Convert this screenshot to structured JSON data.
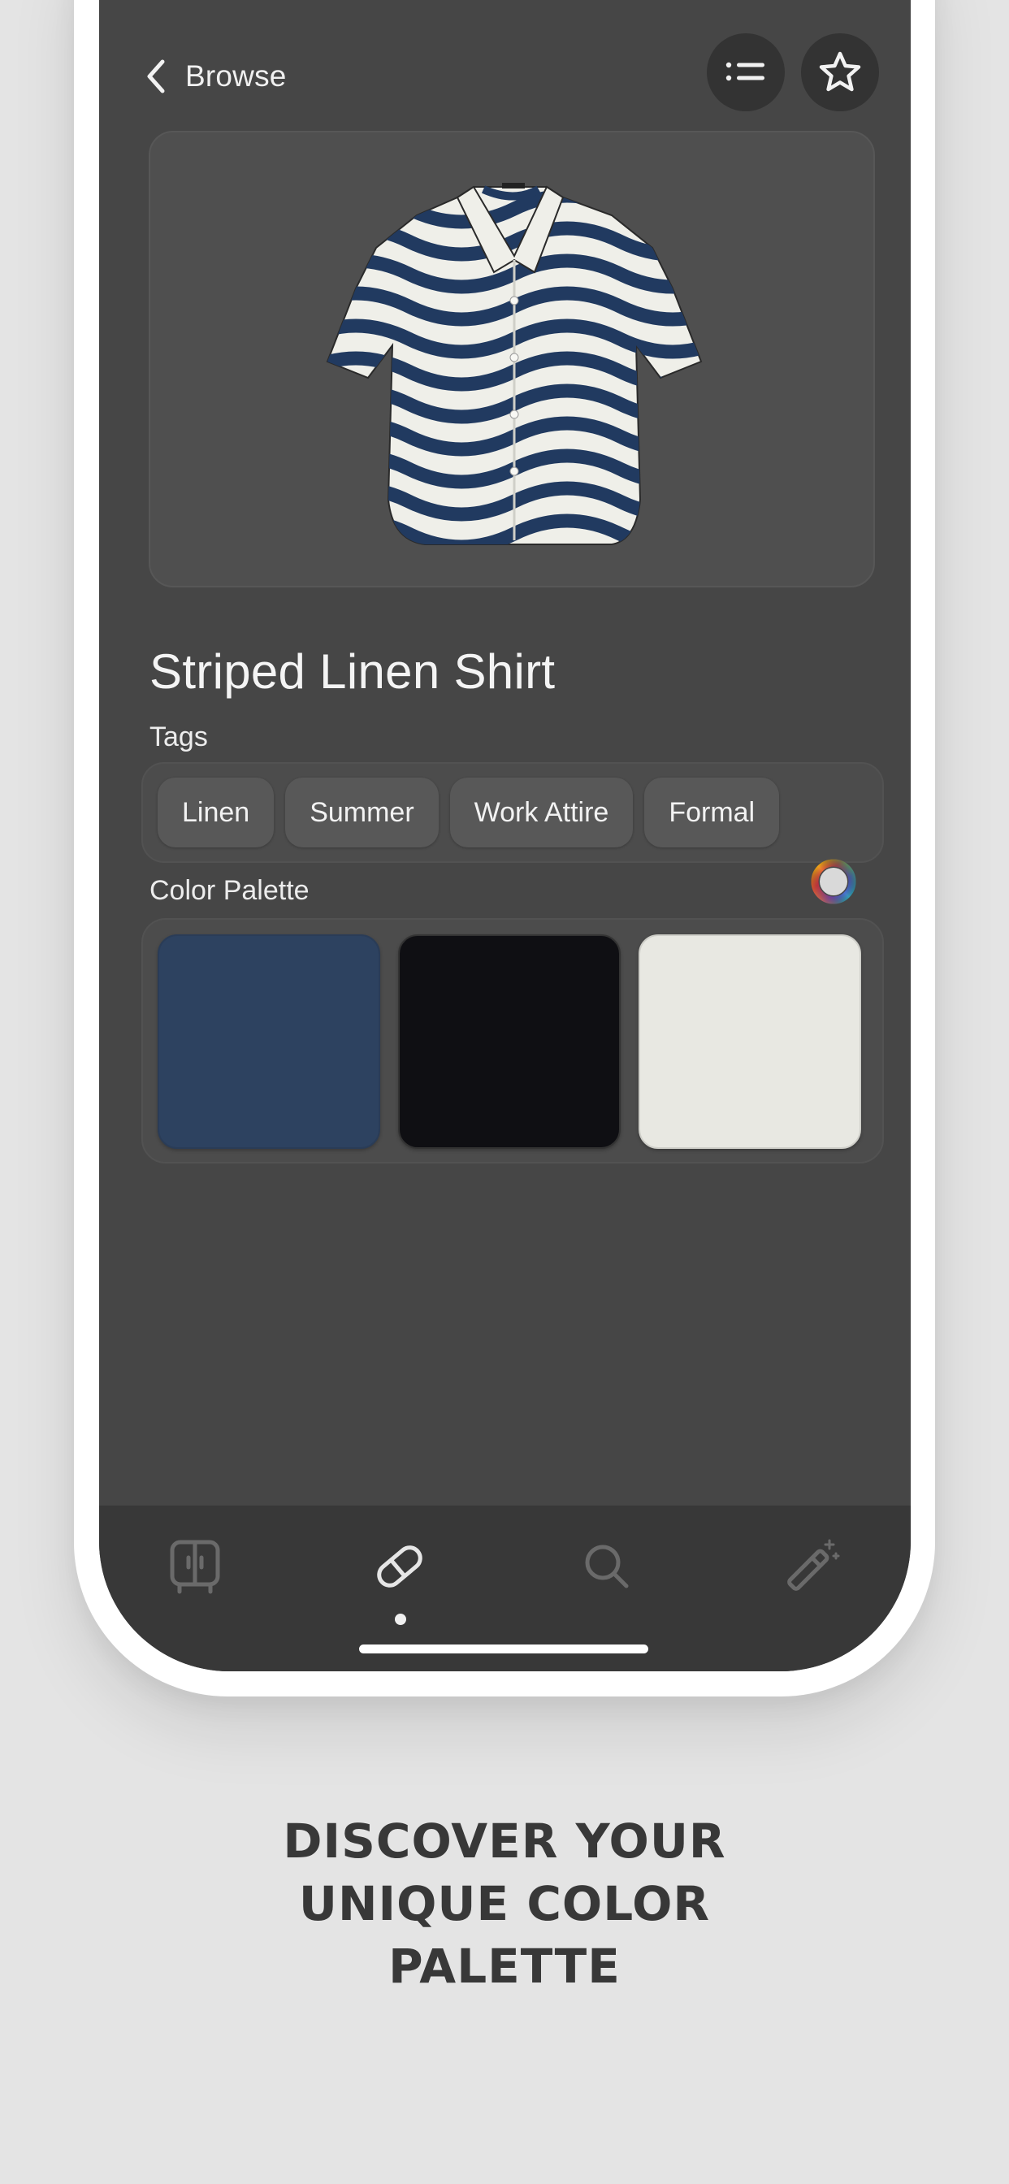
{
  "header": {
    "back_label": "Browse"
  },
  "product": {
    "title": "Striped Linen Shirt",
    "image_alt": "Striped linen shirt with navy and white wavy stripes"
  },
  "tags": {
    "label": "Tags",
    "items": [
      "Linen",
      "Summer",
      "Work Attire",
      "Formal"
    ]
  },
  "palette": {
    "label": "Color Palette",
    "colors": [
      "#2d4260",
      "#0f0f13",
      "#e8e8e2"
    ]
  },
  "tab_bar": {
    "active_tab": "items",
    "tabs": [
      "wardrobe-icon",
      "hanger-tag-icon",
      "search-icon",
      "magic-wand-icon"
    ]
  },
  "promo": {
    "line1": "DISCOVER YOUR",
    "line2": "UNIQUE COLOR",
    "line3": "PALETTE"
  },
  "theme": {
    "screen_bg": "#464646",
    "page_bg": "#e4e4e4",
    "accent_text": "#f4f4f4"
  }
}
